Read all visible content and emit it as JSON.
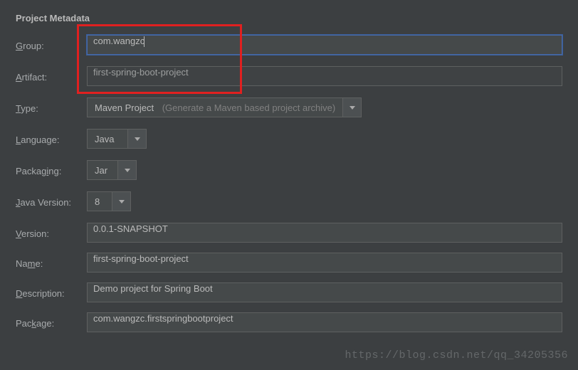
{
  "title": "Project Metadata",
  "labels": {
    "group": {
      "u": "G",
      "rest": "roup:"
    },
    "artifact": {
      "u": "A",
      "rest": "rtifact:"
    },
    "type": {
      "u": "T",
      "rest": "ype:"
    },
    "language": {
      "u": "L",
      "rest": "anguage:"
    },
    "packaging": {
      "pre": "Packag",
      "u": "i",
      "rest": "ng:"
    },
    "javaVersion": {
      "u": "J",
      "rest": "ava Version:"
    },
    "version": {
      "u": "V",
      "rest": "ersion:"
    },
    "name": {
      "pre": "Na",
      "u": "m",
      "rest": "e:"
    },
    "description": {
      "u": "D",
      "rest": "escription:"
    },
    "package": {
      "pre": "Pac",
      "u": "k",
      "rest": "age:"
    }
  },
  "fields": {
    "group": "com.wangzc",
    "artifact": "first-spring-boot-project",
    "type": {
      "value": "Maven Project",
      "hint": "(Generate a Maven based project archive)"
    },
    "language": "Java",
    "packaging": "Jar",
    "javaVersion": "8",
    "version": "0.0.1-SNAPSHOT",
    "name": "first-spring-boot-project",
    "description": "Demo project for Spring Boot",
    "package": "com.wangzc.firstspringbootproject"
  },
  "watermark": "https://blog.csdn.net/qq_34205356"
}
